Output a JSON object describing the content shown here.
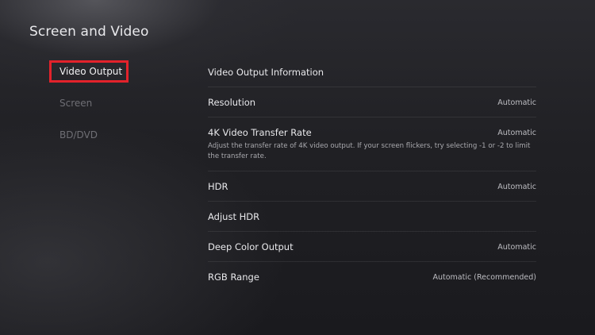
{
  "page": {
    "title": "Screen and Video"
  },
  "nav": {
    "items": [
      {
        "label": "Video Output",
        "selected": true
      },
      {
        "label": "Screen",
        "selected": false
      },
      {
        "label": "BD/DVD",
        "selected": false
      }
    ]
  },
  "settings": {
    "items": [
      {
        "label": "Video Output Information",
        "value": "",
        "description": ""
      },
      {
        "label": "Resolution",
        "value": "Automatic",
        "description": ""
      },
      {
        "label": "4K Video Transfer Rate",
        "value": "Automatic",
        "description": "Adjust the transfer rate of 4K video output. If your screen flickers, try selecting -1 or -2 to limit the transfer rate."
      },
      {
        "label": "HDR",
        "value": "Automatic",
        "description": ""
      },
      {
        "label": "Adjust HDR",
        "value": "",
        "description": ""
      },
      {
        "label": "Deep Color Output",
        "value": "Automatic",
        "description": ""
      },
      {
        "label": "RGB Range",
        "value": "Automatic (Recommended)",
        "description": ""
      }
    ]
  },
  "colors": {
    "selection_outline": "#e3222b",
    "background": "#202024"
  }
}
